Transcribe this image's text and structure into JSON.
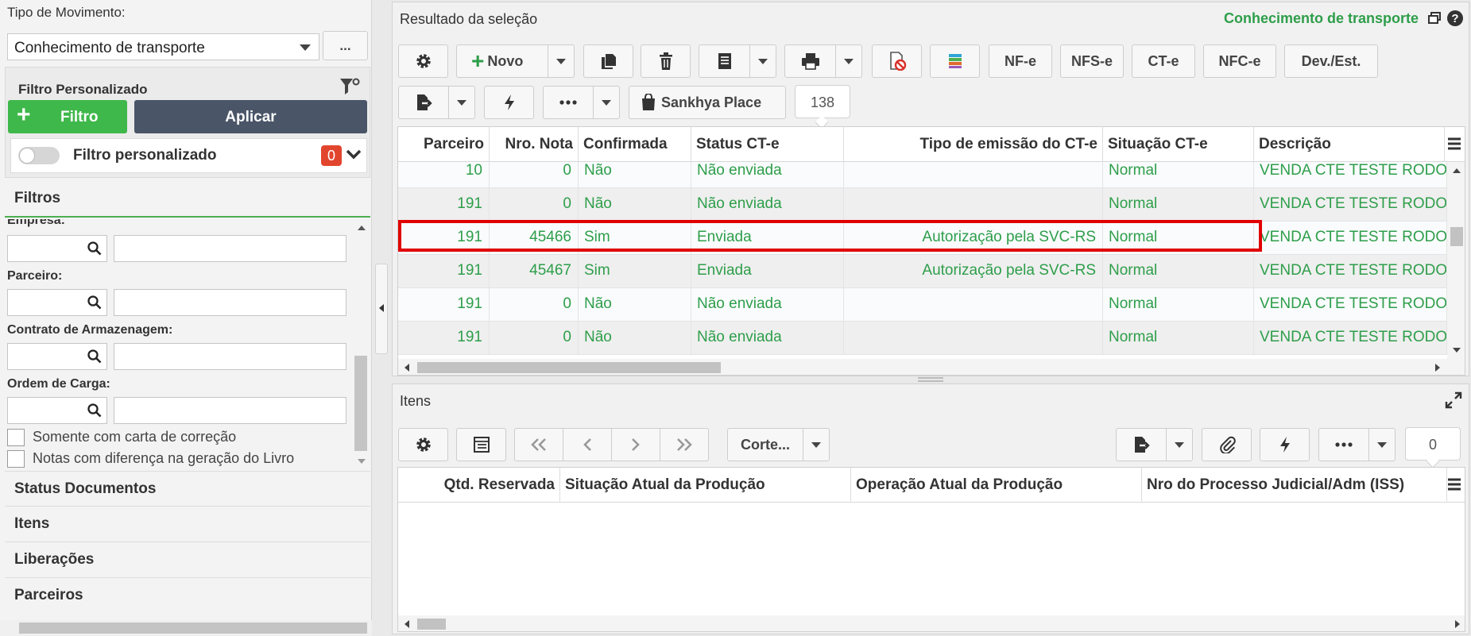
{
  "left": {
    "tipo_label": "Tipo de Movimento:",
    "tipo_value": "Conhecimento de transporte",
    "more_btn": "...",
    "filtro_pers_title": "Filtro Personalizado",
    "filtro_btn": "Filtro",
    "aplicar_btn": "Aplicar",
    "filtro_toggle_label": "Filtro personalizado",
    "filtro_count": "0",
    "filtros_title": "Filtros",
    "empresa_label": "Empresa:",
    "parceiro_label": "Parceiro:",
    "contrato_label": "Contrato de Armazenagem:",
    "ordem_label": "Ordem de Carga:",
    "chk1": "Somente com carta de correção",
    "chk2": "Notas com diferença na geração do Livro",
    "sections": [
      "Status Documentos",
      "Itens",
      "Liberações",
      "Parceiros"
    ]
  },
  "result": {
    "title": "Resultado da seleção",
    "doc_type": "Conhecimento de transporte",
    "novo": "Novo",
    "nfe": "NF-e",
    "nfse": "NFS-e",
    "cte": "CT-e",
    "nfce": "NFC-e",
    "devest": "Dev./Est.",
    "sankhya": "Sankhya Place",
    "count": "138",
    "columns": [
      "Parceiro",
      "Nro. Nota",
      "Confirmada",
      "Status CT-e",
      "Tipo de emissão do CT-e",
      "Situação CT-e",
      "Descrição"
    ],
    "rows": [
      [
        "10",
        "0",
        "Não",
        "Não enviada",
        "",
        "Normal",
        "VENDA CTE TESTE RODO"
      ],
      [
        "191",
        "0",
        "Não",
        "Não enviada",
        "",
        "Normal",
        "VENDA CTE TESTE RODO"
      ],
      [
        "191",
        "45466",
        "Sim",
        "Enviada",
        "Autorização pela SVC-RS",
        "Normal",
        "VENDA CTE TESTE RODO"
      ],
      [
        "191",
        "45467",
        "Sim",
        "Enviada",
        "Autorização pela SVC-RS",
        "Normal",
        "VENDA CTE TESTE RODO"
      ],
      [
        "191",
        "0",
        "Não",
        "Não enviada",
        "",
        "Normal",
        "VENDA CTE TESTE RODO"
      ],
      [
        "191",
        "0",
        "Não",
        "Não enviada",
        "",
        "Normal",
        "VENDA CTE TESTE RODO"
      ]
    ],
    "highlight_color": "#e00000",
    "text_color": "#2e9e4a"
  },
  "itens": {
    "title": "Itens",
    "corte": "Corte...",
    "count": "0",
    "columns": [
      "Qtd. Reservada",
      "Situação Atual da Produção",
      "Operação Atual da Produção",
      "Nro do Processo Judicial/Adm (ISS)"
    ]
  }
}
